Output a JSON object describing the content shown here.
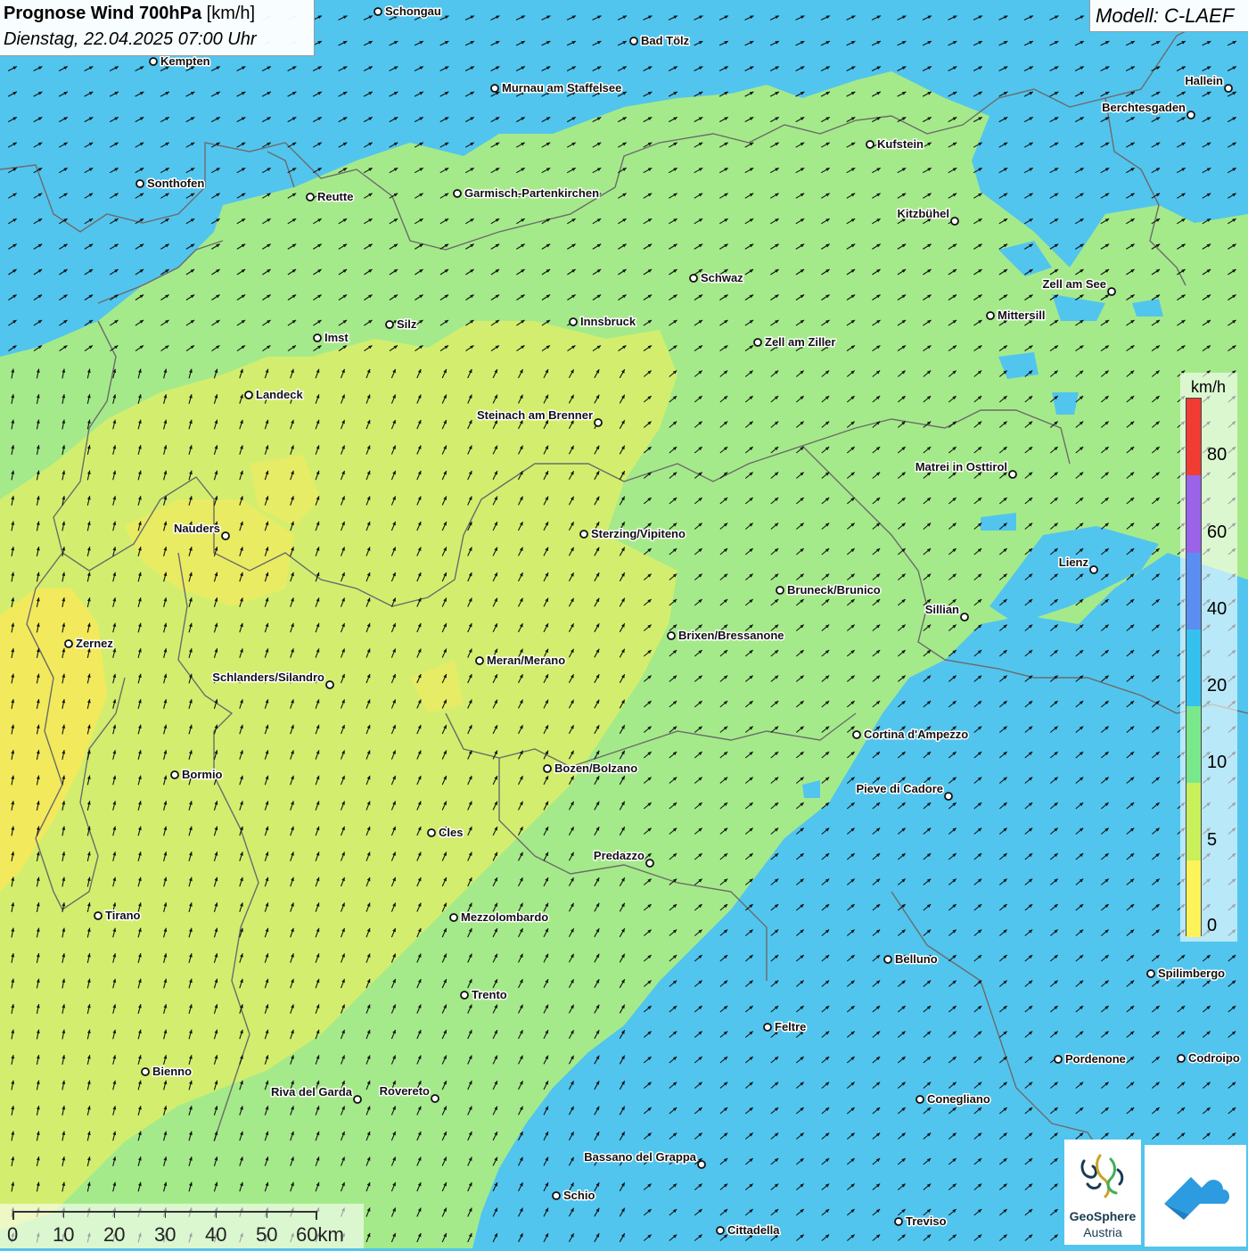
{
  "title": {
    "main": "Prognose Wind 700hPa",
    "unit": "[km/h]",
    "datetime": "Dienstag, 22.04.2025 07:00 Uhr"
  },
  "model": "Modell: C-LAEF",
  "legend": {
    "unit": "km/h",
    "ticks": [
      "80",
      "60",
      "40",
      "20",
      "10",
      "5",
      "0"
    ],
    "colors": [
      "#f03c32",
      "#9a63e8",
      "#5a8ef0",
      "#35c1f0",
      "#79e88b",
      "#c8f05a",
      "#fff35a"
    ]
  },
  "scale_bar": {
    "labels": [
      "0",
      "10",
      "20",
      "30",
      "40",
      "50",
      "60km"
    ]
  },
  "logos": {
    "geosphere_name": "GeoSphere",
    "geosphere_sub": "Austria",
    "app_icon": "wetter-app-icon"
  },
  "colors": {
    "background_blue": "#52c5ee",
    "light_green": "#a5ea8a",
    "yellow_green": "#d3ee6e",
    "yellow": "#f2ea5c",
    "arrow": "#111111",
    "border": "#6b6b6b"
  },
  "wind": {
    "predominant_direction": "south-west to north-east",
    "speed_range_kmh": [
      0,
      40
    ]
  },
  "cities": [
    {
      "name": "Schongau"
    },
    {
      "name": "Bad Tölz"
    },
    {
      "name": "Kempten"
    },
    {
      "name": "Murnau am Staffelsee"
    },
    {
      "name": "Hallein"
    },
    {
      "name": "Berchtesgaden"
    },
    {
      "name": "Kufstein"
    },
    {
      "name": "Sonthofen"
    },
    {
      "name": "Reutte"
    },
    {
      "name": "Garmisch-Partenkirchen"
    },
    {
      "name": "Kitzbühel"
    },
    {
      "name": "Schwaz"
    },
    {
      "name": "Zell am See"
    },
    {
      "name": "Mittersill"
    },
    {
      "name": "Silz"
    },
    {
      "name": "Innsbruck"
    },
    {
      "name": "Imst"
    },
    {
      "name": "Zell am Ziller"
    },
    {
      "name": "Landeck"
    },
    {
      "name": "Steinach am Brenner"
    },
    {
      "name": "Matrei in Osttirol"
    },
    {
      "name": "Nauders"
    },
    {
      "name": "Sterzing/Vipiteno"
    },
    {
      "name": "Lienz"
    },
    {
      "name": "Bruneck/Brunico"
    },
    {
      "name": "Sillian"
    },
    {
      "name": "Brixen/Bressanone"
    },
    {
      "name": "Zernez"
    },
    {
      "name": "Meran/Merano"
    },
    {
      "name": "Schlanders/Silandro"
    },
    {
      "name": "Cortina d'Ampezzo"
    },
    {
      "name": "Bozen/Bolzano"
    },
    {
      "name": "Bormio"
    },
    {
      "name": "Pieve di Cadore"
    },
    {
      "name": "Cles"
    },
    {
      "name": "Predazzo"
    },
    {
      "name": "Tirano"
    },
    {
      "name": "Mezzolombardo"
    },
    {
      "name": "Belluno"
    },
    {
      "name": "Spilimbergo"
    },
    {
      "name": "Trento"
    },
    {
      "name": "Feltre"
    },
    {
      "name": "Pordenone"
    },
    {
      "name": "Codroipo"
    },
    {
      "name": "Bienno"
    },
    {
      "name": "Riva del Garda"
    },
    {
      "name": "Rovereto"
    },
    {
      "name": "Conegliano"
    },
    {
      "name": "Bassano del Grappa"
    },
    {
      "name": "Schio"
    },
    {
      "name": "Treviso"
    },
    {
      "name": "Cittadella"
    }
  ]
}
